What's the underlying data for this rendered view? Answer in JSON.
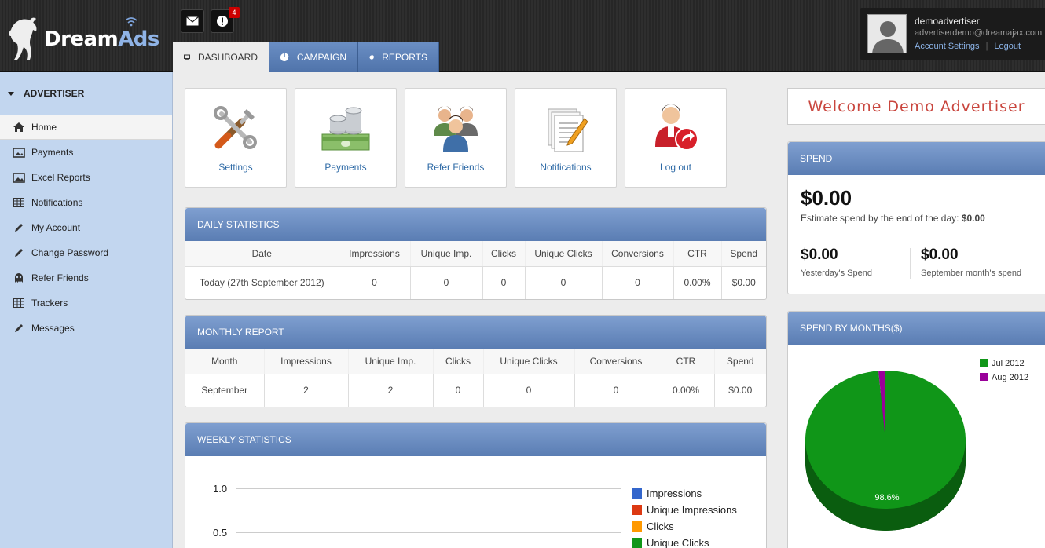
{
  "brand": {
    "name_dream": "Dream",
    "name_ads": "Ads"
  },
  "header": {
    "mail_icon": "envelope-icon",
    "alert_icon": "alert-icon",
    "alert_count": "4",
    "tabs": [
      {
        "label": "Dashboard",
        "icon": "monitor-icon"
      },
      {
        "label": "Campaign",
        "icon": "pie-icon"
      },
      {
        "label": "Reports",
        "icon": "pie-icon"
      }
    ]
  },
  "user": {
    "name": "demoadvertiser",
    "email": "advertiserdemo@dreamajax.com",
    "account_settings": "Account Settings",
    "logout": "Logout"
  },
  "sidebar": {
    "heading": "ADVERTISER",
    "items": [
      {
        "label": "Home",
        "icon": "home-icon"
      },
      {
        "label": "Payments",
        "icon": "image-icon"
      },
      {
        "label": "Excel Reports",
        "icon": "image-icon"
      },
      {
        "label": "Notifications",
        "icon": "grid-icon"
      },
      {
        "label": "My Account",
        "icon": "pencil-icon"
      },
      {
        "label": "Change Password",
        "icon": "pencil-icon"
      },
      {
        "label": "Refer Friends",
        "icon": "ghost-icon"
      },
      {
        "label": "Trackers",
        "icon": "grid-icon"
      },
      {
        "label": "Messages",
        "icon": "pencil-icon"
      }
    ]
  },
  "tiles": [
    {
      "label": "Settings",
      "icon": "tools-icon"
    },
    {
      "label": "Payments",
      "icon": "money-icon"
    },
    {
      "label": "Refer Friends",
      "icon": "people-icon"
    },
    {
      "label": "Notifications",
      "icon": "documents-icon"
    },
    {
      "label": "Log out",
      "icon": "logout-user-icon"
    }
  ],
  "daily": {
    "title": "DAILY STATISTICS",
    "headers": [
      "Date",
      "Impressions",
      "Unique Imp.",
      "Clicks",
      "Unique Clicks",
      "Conversions",
      "CTR",
      "Spend"
    ],
    "row": [
      "Today (27th September 2012)",
      "0",
      "0",
      "0",
      "0",
      "0",
      "0.00%",
      "$0.00"
    ]
  },
  "monthly": {
    "title": "MONTHLY REPORT",
    "headers": [
      "Month",
      "Impressions",
      "Unique Imp.",
      "Clicks",
      "Unique Clicks",
      "Conversions",
      "CTR",
      "Spend"
    ],
    "row": [
      "September",
      "2",
      "2",
      "0",
      "0",
      "0",
      "0.00%",
      "$0.00"
    ]
  },
  "weekly": {
    "title": "WEEKLY STATISTICS",
    "legend": [
      {
        "name": "Impressions",
        "color": "#3366cc"
      },
      {
        "name": "Unique Impressions",
        "color": "#dc3912"
      },
      {
        "name": "Clicks",
        "color": "#ff9900"
      },
      {
        "name": "Unique Clicks",
        "color": "#109618"
      }
    ],
    "y_ticks": [
      "1.0",
      "0.5"
    ]
  },
  "welcome": "Welcome Demo Advertiser",
  "spend": {
    "title": "SPEND",
    "amount": "$0.00",
    "estimate_label": "Estimate spend by the end of the day:",
    "estimate_value": "$0.00",
    "yesterday_amount": "$0.00",
    "yesterday_label": "Yesterday's Spend",
    "month_amount": "$0.00",
    "month_label": "September month's spend"
  },
  "chart_data": {
    "type": "pie",
    "title": "SPEND BY MONTHS($)",
    "categories": [
      "Jul 2012",
      "Aug 2012"
    ],
    "values": [
      98.6,
      1.4
    ],
    "colors": [
      "#109618",
      "#990099"
    ],
    "data_label": "98.6%",
    "legend": "top-right"
  }
}
